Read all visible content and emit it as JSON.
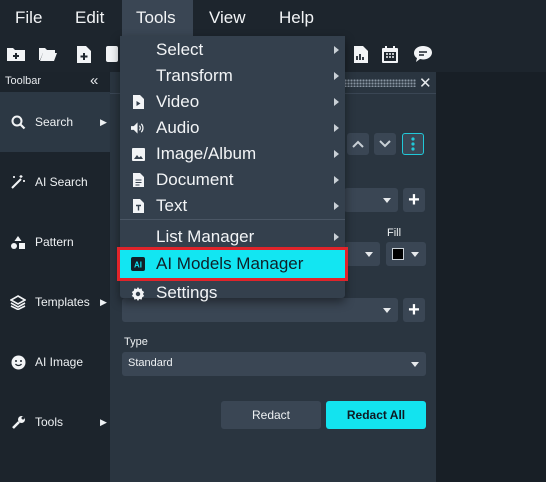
{
  "menubar": {
    "items": [
      "File",
      "Edit",
      "Tools",
      "View",
      "Help"
    ],
    "active": "Tools"
  },
  "toolbar_panel": {
    "title": "Toolbar",
    "collapse_glyph": "«",
    "items": [
      {
        "label": "Search",
        "icon": "search-icon"
      },
      {
        "label": "AI Search",
        "icon": "magic-wand-icon"
      },
      {
        "label": "Pattern",
        "icon": "shapes-icon"
      },
      {
        "label": "Templates",
        "icon": "layers-icon"
      },
      {
        "label": "AI Image",
        "icon": "smiley-icon"
      },
      {
        "label": "Tools",
        "icon": "wrench-icon"
      }
    ]
  },
  "tools_menu": {
    "items": [
      {
        "label": "Select",
        "icon": "",
        "submenu": true
      },
      {
        "label": "Transform",
        "icon": "",
        "submenu": true
      },
      {
        "label": "Video",
        "icon": "video-file-icon",
        "submenu": true
      },
      {
        "label": "Audio",
        "icon": "speaker-icon",
        "submenu": true
      },
      {
        "label": "Image/Album",
        "icon": "image-icon",
        "submenu": true
      },
      {
        "label": "Document",
        "icon": "document-icon",
        "submenu": true
      },
      {
        "label": "Text",
        "icon": "text-file-icon",
        "submenu": true
      },
      {
        "label": "List Manager",
        "icon": "",
        "submenu": true
      },
      {
        "label": "AI Models Manager",
        "icon": "ai-badge-icon",
        "submenu": false
      },
      {
        "label": "Settings",
        "icon": "gear-icon",
        "submenu": false
      }
    ],
    "highlight_color": "#e0242a",
    "hover_color": "#12e6f2"
  },
  "panel": {
    "fill_label": "Fill",
    "type_label": "Type",
    "type_value": "Standard",
    "redact_label": "Redact",
    "redact_all_label": "Redact All"
  },
  "colors": {
    "accent": "#13e3ef",
    "background": "#1c242c",
    "panel": "#2a3540"
  }
}
